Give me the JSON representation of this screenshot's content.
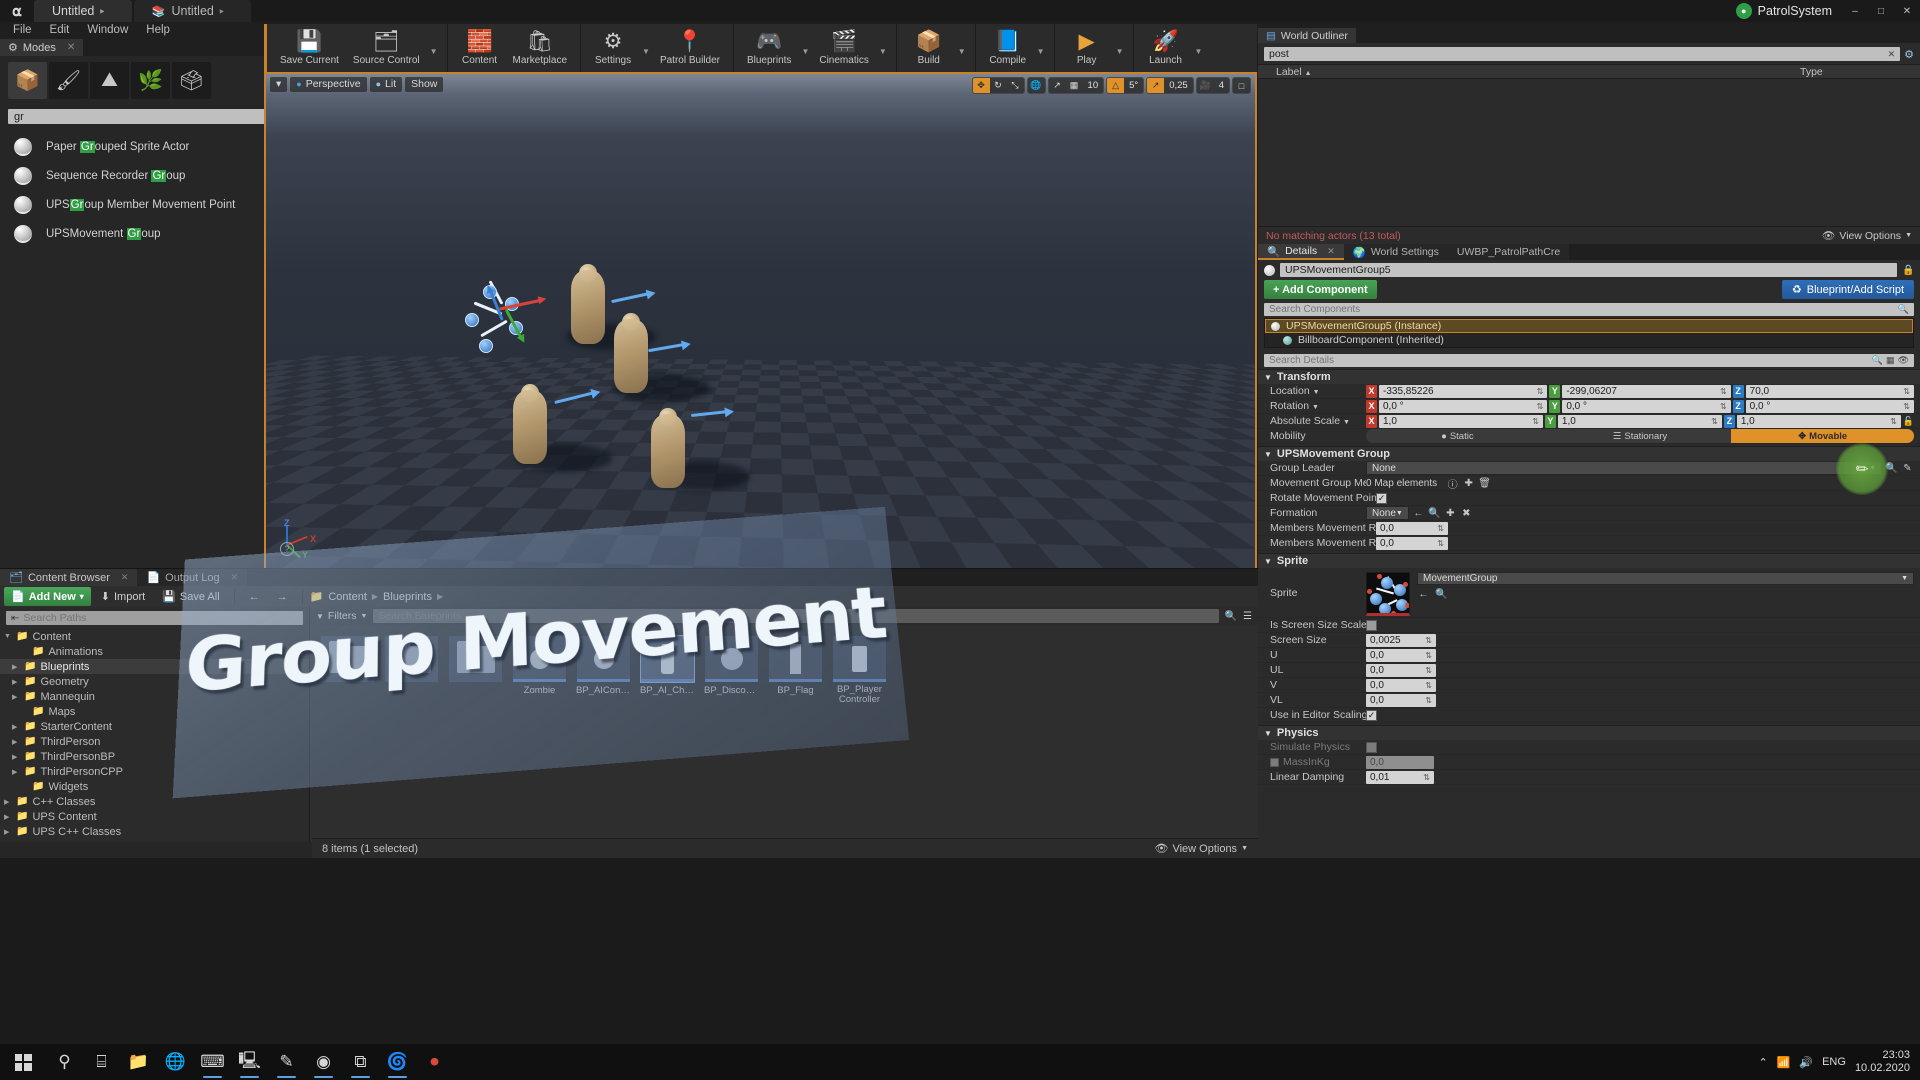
{
  "titlebar": {
    "logo_icon": "unreal-logo-icon",
    "tabs": [
      {
        "label": "Untitled",
        "modified": "‣",
        "icon": "unreal-tab-icon"
      },
      {
        "label": "Untitled",
        "modified": "‣",
        "icon": "level-editor-icon"
      }
    ],
    "project_name": "PatrolSystem",
    "project_icon": "project-dot-icon",
    "window_controls": [
      "–",
      "□",
      "✕"
    ]
  },
  "menubar": [
    "File",
    "Edit",
    "Window",
    "Help"
  ],
  "modes_panel": {
    "tab_label": "Modes",
    "tab_icon": "modes-icon",
    "close_icon": "✕",
    "mode_buttons": [
      {
        "name": "place-mode",
        "icon": "📦",
        "active": true
      },
      {
        "name": "paint-mode",
        "icon": "🖌"
      },
      {
        "name": "landscape-mode",
        "icon": "⛰"
      },
      {
        "name": "foliage-mode",
        "icon": "🌿"
      },
      {
        "name": "geometry-mode",
        "icon": "🗳"
      }
    ],
    "search_value": "gr",
    "search_clear_icon": "✕",
    "results": [
      {
        "prefix": "Paper ",
        "match": "Gr",
        "suffix": "ouped Sprite Actor"
      },
      {
        "prefix": "Sequence Recorder ",
        "match": "Gr",
        "suffix": "oup"
      },
      {
        "prefix": "UPS",
        "match": "Gr",
        "suffix": "oup Member Movement Point"
      },
      {
        "prefix": "UPSMovement ",
        "match": "Gr",
        "suffix": "oup"
      }
    ]
  },
  "toolbar": {
    "groups": [
      {
        "items": [
          {
            "label": "Save Current",
            "icon": "💾",
            "name": "save-current-button"
          },
          {
            "label": "Source Control",
            "icon": "🗂",
            "name": "source-control-button",
            "caret": true
          }
        ]
      },
      {
        "items": [
          {
            "label": "Content",
            "icon": "🧱",
            "name": "content-button"
          },
          {
            "label": "Marketplace",
            "icon": "🛍",
            "name": "marketplace-button"
          }
        ]
      },
      {
        "items": [
          {
            "label": "Settings",
            "icon": "⚙",
            "name": "settings-button",
            "caret": true
          },
          {
            "label": "Patrol Builder",
            "icon": "📍",
            "name": "patrol-builder-button"
          }
        ]
      },
      {
        "items": [
          {
            "label": "Blueprints",
            "icon": "🎮",
            "name": "blueprints-button",
            "caret": true
          },
          {
            "label": "Cinematics",
            "icon": "🎬",
            "name": "cinematics-button",
            "caret": true
          }
        ]
      },
      {
        "items": [
          {
            "label": "Build",
            "icon": "📦",
            "name": "build-button",
            "caret": true
          }
        ]
      },
      {
        "items": [
          {
            "label": "Compile",
            "icon": "📘",
            "name": "compile-button",
            "caret": true
          }
        ]
      },
      {
        "items": [
          {
            "label": "Play",
            "icon": "▶",
            "name": "play-button",
            "caret": true
          }
        ]
      },
      {
        "items": [
          {
            "label": "Launch",
            "icon": "🚀",
            "name": "launch-button",
            "caret": true
          }
        ]
      }
    ]
  },
  "viewport": {
    "menu_icon": "▾",
    "perspective_label": "Perspective",
    "perspective_icon": "📷",
    "lit_label": "Lit",
    "lit_icon": "💡",
    "show_label": "Show",
    "gizmo_buttons": [
      {
        "name": "translate-gizmo",
        "icon": "✥",
        "active": true
      },
      {
        "name": "rotate-gizmo",
        "icon": "↻",
        "active": false
      },
      {
        "name": "scale-gizmo",
        "icon": "⤡",
        "active": false
      }
    ],
    "coord_icon": "🌐",
    "surface_snap_icon": "↗",
    "grid_snap_icon": "▦",
    "grid_snap_value": "10",
    "angle_snap_icon": "△",
    "angle_snap_value": "5°",
    "scale_snap_icon": "↗",
    "scale_snap_value": "0,25",
    "camera_speed_icon": "🎥",
    "camera_speed_value": "4",
    "maximize_icon": "□",
    "axis_labels": {
      "x": "X",
      "y": "Y",
      "z": "Z"
    },
    "help_icon": "?"
  },
  "world_outliner": {
    "title": "World Outliner",
    "title_icon": "outliner-icon",
    "search_value": "post",
    "search_clear_icon": "✕",
    "settings_icon": "⚙",
    "columns": [
      "Label",
      "Type"
    ],
    "sort_icon": "▲",
    "empty_message": "No matching actors (13 total)",
    "view_options_label": "View Options",
    "view_options_icon": "👁"
  },
  "details": {
    "tabs": [
      {
        "label": "Details",
        "icon": "🔍",
        "active": true,
        "closable": true
      },
      {
        "label": "World Settings",
        "icon": "🌍",
        "active": false
      },
      {
        "label": "UWBP_PatrolPathCre",
        "icon": "",
        "active": false
      }
    ],
    "actor_name": "UPSMovementGroup5",
    "lock_icon": "🔒",
    "add_component_label": "+ Add Component",
    "blueprint_button_label": "Blueprint/Add Script",
    "blueprint_button_icon": "♻",
    "components_search_placeholder": "Search Components",
    "components": [
      {
        "label": "UPSMovementGroup5 (Instance)",
        "selected": true,
        "color": "#d8d8d8"
      },
      {
        "label": "BillboardComponent (Inherited)",
        "selected": false,
        "color": "#7fb9b4"
      }
    ],
    "details_search_placeholder": "Search Details",
    "details_search_icon": "🔍",
    "details_grid_icon": "▦",
    "details_eye_icon": "👁",
    "sections": {
      "transform": {
        "title": "Transform",
        "rows": [
          {
            "label": "Location",
            "dropdown": true,
            "type": "vector",
            "values": [
              "-335,85226",
              "-299,06207",
              "70,0"
            ]
          },
          {
            "label": "Rotation",
            "dropdown": true,
            "type": "vector",
            "values": [
              "0,0 °",
              "0,0 °",
              "0,0 °"
            ]
          },
          {
            "label": "Absolute Scale",
            "dropdown": true,
            "type": "vector",
            "values": [
              "1,0",
              "1,0",
              "1,0"
            ],
            "lock_icon": "🔓"
          },
          {
            "label": "Mobility",
            "type": "mobility",
            "options": [
              {
                "label": "Static",
                "icon": "●",
                "active": false
              },
              {
                "label": "Stationary",
                "icon": "☰",
                "active": false
              },
              {
                "label": "Movable",
                "icon": "✥",
                "active": true
              }
            ]
          }
        ]
      },
      "movement_group": {
        "title": "UPSMovement Group",
        "rows": [
          {
            "label": "Group Leader",
            "type": "dropdown",
            "value": "None",
            "icons": [
              "🔍",
              "✎"
            ]
          },
          {
            "label": "Movement Group Members",
            "type": "map",
            "value": "0 Map elements",
            "icons": [
              "ⓘ",
              "✚",
              "🗑"
            ]
          },
          {
            "label": "Rotate Movement Points Arour",
            "type": "checkbox",
            "checked": true
          },
          {
            "label": "Formation",
            "type": "dropdown-small",
            "value": "None",
            "icons": [
              "←",
              "🔍",
              "✚",
              "✖"
            ]
          },
          {
            "label": "Members Movement Reaction",
            "type": "number",
            "value": "0,0"
          },
          {
            "label": "Members Movement Reaction",
            "type": "number",
            "value": "0,0"
          }
        ]
      },
      "sprite": {
        "title": "Sprite",
        "rows": [
          {
            "label": "Sprite",
            "type": "asset",
            "value": "MovementGroup",
            "icons": [
              "←",
              "🔍"
            ]
          },
          {
            "label": "Is Screen Size Scaled",
            "type": "checkbox",
            "checked": false
          },
          {
            "label": "Screen Size",
            "type": "number",
            "value": "0,0025"
          },
          {
            "label": "U",
            "type": "number",
            "value": "0,0"
          },
          {
            "label": "UL",
            "type": "number",
            "value": "0,0"
          },
          {
            "label": "V",
            "type": "number",
            "value": "0,0"
          },
          {
            "label": "VL",
            "type": "number",
            "value": "0,0"
          },
          {
            "label": "Use in Editor Scaling",
            "type": "checkbox",
            "checked": true
          }
        ]
      },
      "physics": {
        "title": "Physics",
        "rows": [
          {
            "label": "Simulate Physics",
            "type": "checkbox",
            "checked": false,
            "disabled": true
          },
          {
            "label": "MassInKg",
            "type": "number",
            "value": "0,0",
            "disabled": true,
            "has_checkbox": true
          },
          {
            "label": "Linear Damping",
            "type": "number",
            "value": "0,01"
          }
        ]
      }
    }
  },
  "content_browser": {
    "tabs": [
      {
        "label": "Content Browser",
        "icon": "🗂",
        "active": true,
        "closable": true
      },
      {
        "label": "Output Log",
        "icon": "📄",
        "active": false,
        "closable": true
      }
    ],
    "toolbar": {
      "add_new_label": "Add New",
      "add_new_icon": "📄",
      "add_new_caret": "▾",
      "import_label": "Import",
      "import_icon": "⬇",
      "save_all_label": "Save All",
      "save_all_icon": "💾",
      "back_icon": "←",
      "forward_icon": "→",
      "folder_icon": "📁",
      "breadcrumb": [
        "Content",
        "Blueprints"
      ]
    },
    "path_search_placeholder": "Search Paths",
    "collapse_icon": "⇤",
    "tree": [
      {
        "label": "Content",
        "depth": 0,
        "expanded": true,
        "has_children": true
      },
      {
        "label": "Animations",
        "depth": 1,
        "has_children": false
      },
      {
        "label": "Blueprints",
        "depth": 1,
        "has_children": true,
        "selected": true
      },
      {
        "label": "Geometry",
        "depth": 1,
        "has_children": true
      },
      {
        "label": "Mannequin",
        "depth": 1,
        "has_children": true
      },
      {
        "label": "Maps",
        "depth": 1,
        "has_children": false
      },
      {
        "label": "StarterContent",
        "depth": 1,
        "has_children": true
      },
      {
        "label": "ThirdPerson",
        "depth": 1,
        "has_children": true
      },
      {
        "label": "ThirdPersonBP",
        "depth": 1,
        "has_children": true
      },
      {
        "label": "ThirdPersonCPP",
        "depth": 1,
        "has_children": true
      },
      {
        "label": "Widgets",
        "depth": 1,
        "has_children": false
      },
      {
        "label": "C++ Classes",
        "depth": 0,
        "has_children": true
      },
      {
        "label": "UPS Content",
        "depth": 0,
        "has_children": true
      },
      {
        "label": "UPS C++ Classes",
        "depth": 0,
        "has_children": true
      }
    ],
    "filters_label": "Filters",
    "filters_icon": "▼",
    "asset_search_placeholder": "Search Blueprints",
    "view_search_icon": "🔍",
    "view_list_icon": "☰",
    "assets": [
      {
        "name": "",
        "type": "folder"
      },
      {
        "name": "",
        "type": "folder"
      },
      {
        "name": "",
        "type": "folder"
      },
      {
        "name": "Zombie",
        "type": "blueprint"
      },
      {
        "name": "BP_AIController",
        "type": "blueprint"
      },
      {
        "name": "BP_AI_Character",
        "type": "blueprint",
        "selected": true
      },
      {
        "name": "BP_DiscoBall",
        "type": "blueprint"
      },
      {
        "name": "BP_Flag",
        "type": "blueprint"
      },
      {
        "name": "BP_Player Controller",
        "type": "blueprint"
      }
    ],
    "status_text": "8 items (1 selected)",
    "view_options_label": "View Options",
    "view_options_icon": "👁"
  },
  "banner": {
    "text": "Group Movement"
  },
  "taskbar": {
    "start_icon": "windows-logo-icon",
    "icons": [
      {
        "name": "search-icon",
        "glyph": "⚲"
      },
      {
        "name": "task-view-icon",
        "glyph": "⌸"
      },
      {
        "name": "file-explorer-icon",
        "glyph": "📁"
      },
      {
        "name": "browser-icon",
        "glyph": "🌐"
      },
      {
        "name": "terminal-icon",
        "glyph": "⌨"
      },
      {
        "name": "calc-icon",
        "glyph": "🖳"
      },
      {
        "name": "editor-icon",
        "glyph": "✎"
      },
      {
        "name": "chrome-icon",
        "glyph": "◉"
      },
      {
        "name": "vscode-icon",
        "glyph": "⧉"
      },
      {
        "name": "unreal-icon",
        "glyph": "🌀"
      },
      {
        "name": "record-icon",
        "glyph": "⏺"
      }
    ],
    "tray": {
      "chevron_icon": "⌃",
      "network_icon": "📶",
      "volume_icon": "🔊",
      "language": "ENG",
      "time": "23:03",
      "date": "10.02.2020"
    }
  }
}
